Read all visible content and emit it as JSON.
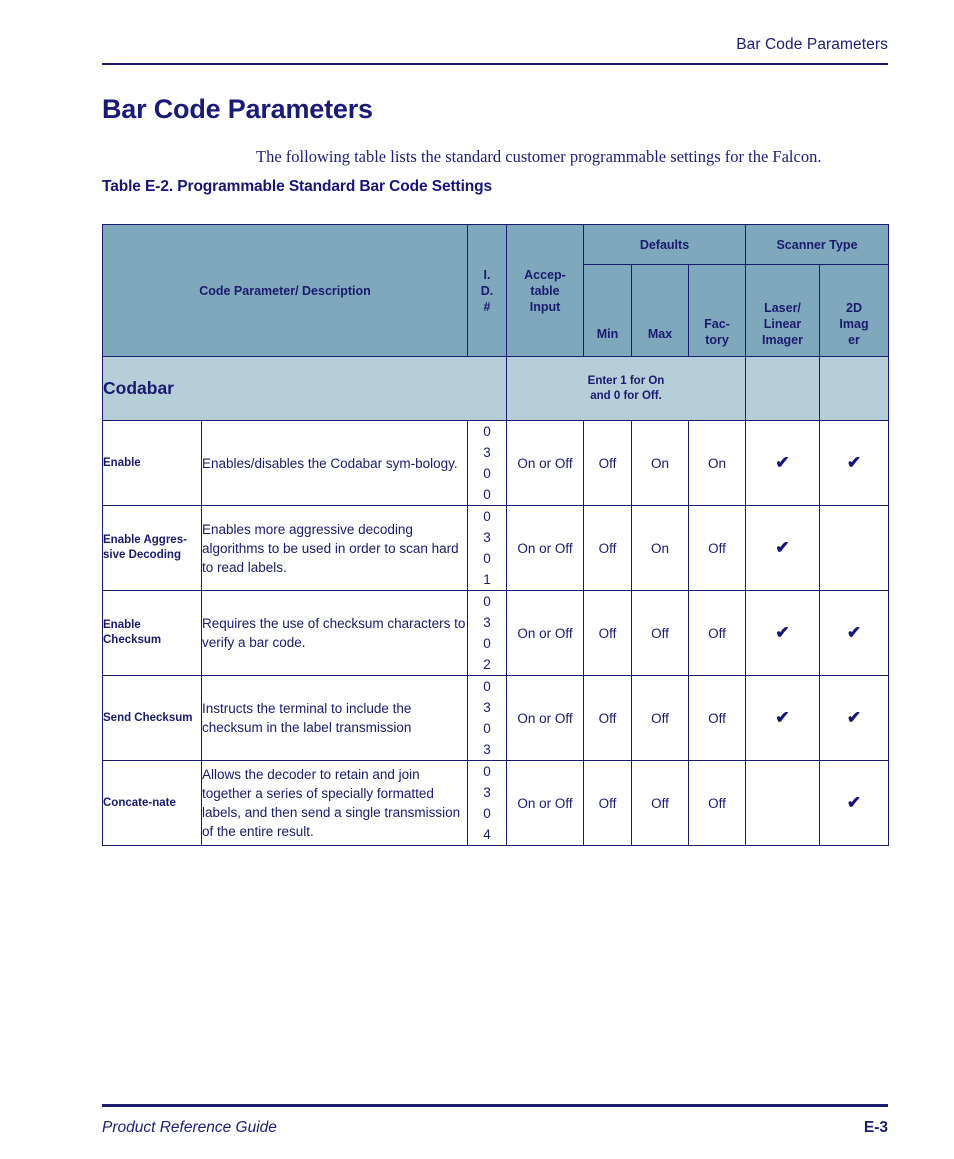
{
  "header": {
    "running_title": "Bar Code Parameters"
  },
  "title": "Bar Code Parameters",
  "intro": "The following table lists the standard customer programmable settings for the Falcon.",
  "table_caption": "Table E-2. Programmable Standard Bar Code Settings",
  "colors": {
    "ink": "#1a1a6e",
    "header_fill": "#7fa8bc",
    "section_fill": "#b6ced8",
    "page_bg": "#ffffff"
  },
  "table": {
    "headers": {
      "code_parameter": "Code Parameter/ Description",
      "id_line1": "I.",
      "id_line2": "D.",
      "id_line3": "#",
      "acceptable_line1": "Accep-",
      "acceptable_line2": "table",
      "acceptable_line3": "Input",
      "defaults_group": "Defaults",
      "scanner_type_group": "Scanner Type",
      "min": "Min",
      "max": "Max",
      "factory_line1": "Fac-",
      "factory_line2": "tory",
      "laser_line1": "Laser/",
      "laser_line2": "Linear",
      "laser_line3": "Imager",
      "imager2d_line1": "2D",
      "imager2d_line2": "Imag",
      "imager2d_line3": "er"
    },
    "section": {
      "name": "Codabar",
      "note_line1": "Enter 1 for On",
      "note_line2": "and 0 for Off."
    },
    "check_glyph": "✔",
    "rows": [
      {
        "name": "Enable",
        "description": "Enables/disables the Codabar sym-bology.",
        "id": "0300",
        "id_digits": [
          "0",
          "3",
          "0",
          "0"
        ],
        "acceptable_input": "On or Off",
        "min": "Off",
        "max": "On",
        "factory": "On",
        "laser_linear_imager": true,
        "imager_2d": true
      },
      {
        "name": "Enable Aggres-sive Decoding",
        "description": "Enables more aggressive decoding algorithms to be used in order to scan hard to read labels.",
        "id": "0301",
        "id_digits": [
          "0",
          "3",
          "0",
          "1"
        ],
        "acceptable_input": "On or Off",
        "min": "Off",
        "max": "On",
        "factory": "Off",
        "laser_linear_imager": true,
        "imager_2d": false
      },
      {
        "name": "Enable Checksum",
        "description": "Requires the use of checksum characters to verify a bar code.",
        "id": "0302",
        "id_digits": [
          "0",
          "3",
          "0",
          "2"
        ],
        "acceptable_input": "On or Off",
        "min": "Off",
        "max": "Off",
        "factory": "Off",
        "laser_linear_imager": true,
        "imager_2d": true
      },
      {
        "name": "Send Checksum",
        "description": "Instructs the terminal to include the checksum in the label transmission",
        "id": "0303",
        "id_digits": [
          "0",
          "3",
          "0",
          "3"
        ],
        "acceptable_input": "On or Off",
        "min": "Off",
        "max": "Off",
        "factory": "Off",
        "laser_linear_imager": true,
        "imager_2d": true
      },
      {
        "name": "Concate-nate",
        "description": "Allows the decoder to retain and join together a series of specially formatted labels, and then send a single transmission of the entire result.",
        "id": "0304",
        "id_digits": [
          "0",
          "3",
          "0",
          "4"
        ],
        "acceptable_input": "On or Off",
        "min": "Off",
        "max": "Off",
        "factory": "Off",
        "laser_linear_imager": false,
        "imager_2d": true
      }
    ]
  },
  "footer": {
    "left": "Product Reference Guide",
    "right": "E-3"
  }
}
